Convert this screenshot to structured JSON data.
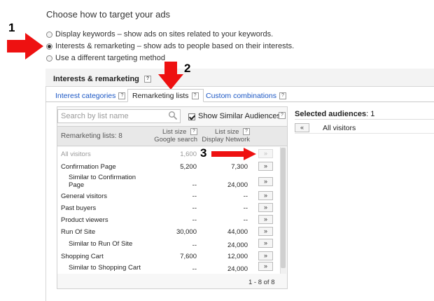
{
  "heading": "Choose how to target your ads",
  "options": [
    {
      "label": "Display keywords – show ads on sites related to your keywords.",
      "selected": false
    },
    {
      "label": "Interests & remarketing – show ads to people based on their interests.",
      "selected": true
    },
    {
      "label": "Use a different targeting method",
      "selected": false
    }
  ],
  "annotations": [
    "1",
    "2",
    "3"
  ],
  "panel": {
    "title": "Interests & remarketing",
    "help": "?"
  },
  "tabs": [
    {
      "label": "Interest categories",
      "active": false
    },
    {
      "label": "Remarketing lists",
      "active": true
    },
    {
      "label": "Custom combinations",
      "active": false
    }
  ],
  "search": {
    "placeholder": "Search by list name",
    "icon": "search-icon"
  },
  "similar": {
    "label": "Show Similar Audiences",
    "checked": true
  },
  "list_header": {
    "title": "Remarketing lists: 8",
    "col1_line1": "List size",
    "col1_line2": "Google search",
    "col2_line1": "List size",
    "col2_line2": "Display Network"
  },
  "rows": [
    {
      "name_lines": [
        "All visitors"
      ],
      "google": "1,600",
      "display": "--",
      "dim": true,
      "indent": false
    },
    {
      "name_lines": [
        "Confirmation Page"
      ],
      "google": "5,200",
      "display": "7,300",
      "dim": false,
      "indent": false
    },
    {
      "name_lines": [
        "Similar to Confirmation",
        "Page"
      ],
      "google": "--",
      "display": "24,000",
      "dim": false,
      "indent": true
    },
    {
      "name_lines": [
        "General visitors"
      ],
      "google": "--",
      "display": "--",
      "dim": false,
      "indent": false
    },
    {
      "name_lines": [
        "Past buyers"
      ],
      "google": "--",
      "display": "--",
      "dim": false,
      "indent": false
    },
    {
      "name_lines": [
        "Product viewers"
      ],
      "google": "--",
      "display": "--",
      "dim": false,
      "indent": false
    },
    {
      "name_lines": [
        "Run Of Site"
      ],
      "google": "30,000",
      "display": "44,000",
      "dim": false,
      "indent": false
    },
    {
      "name_lines": [
        "Similar to Run Of Site"
      ],
      "google": "--",
      "display": "24,000",
      "dim": false,
      "indent": true
    },
    {
      "name_lines": [
        "Shopping Cart"
      ],
      "google": "7,600",
      "display": "12,000",
      "dim": false,
      "indent": false
    },
    {
      "name_lines": [
        "Similar to Shopping Cart"
      ],
      "google": "--",
      "display": "24,000",
      "dim": false,
      "indent": true
    }
  ],
  "add_label": "»",
  "remove_label": "«",
  "pager": "1 - 8 of 8",
  "selected": {
    "title_label": "Selected audiences",
    "count": ": 1",
    "items": [
      "All visitors"
    ]
  },
  "colors": {
    "accent_link": "#1a56c4",
    "annotation_arrow": "#ee1111"
  }
}
